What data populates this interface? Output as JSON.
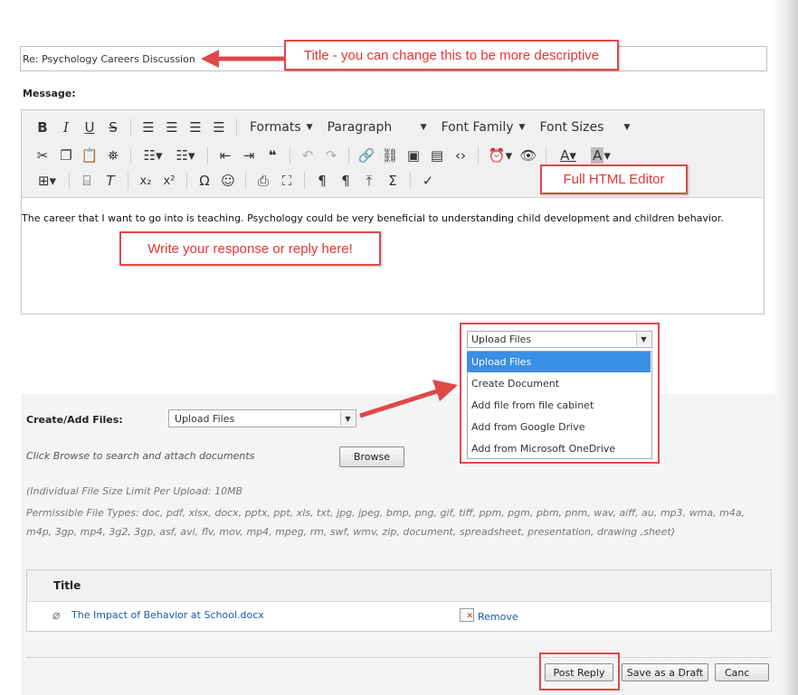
{
  "title_field": {
    "value": "Re: Psychology Careers Discussion"
  },
  "message_label": "Message:",
  "toolbar": {
    "formats": "Formats",
    "paragraph": "Paragraph",
    "font_family": "Font Family",
    "font_sizes": "Font Sizes",
    "row1_icons": [
      "bold-icon",
      "italic-icon",
      "underline-icon",
      "strikethrough-icon",
      "align-left-icon",
      "align-center-icon",
      "align-right-icon",
      "align-justify-icon"
    ],
    "row2_icons": [
      "cut-icon",
      "copy-icon",
      "paste-icon",
      "find-icon",
      "bullet-list-icon",
      "numbered-list-icon",
      "outdent-icon",
      "indent-icon",
      "blockquote-icon",
      "undo-icon",
      "redo-icon",
      "link-icon",
      "unlink-icon",
      "image-icon",
      "media-icon",
      "code-icon",
      "time-icon",
      "preview-icon",
      "text-color-icon",
      "background-color-icon"
    ],
    "row3_icons": [
      "table-icon",
      "horizontal-rule-icon",
      "clear-format-icon",
      "subscript-icon",
      "superscript-icon",
      "special-char-icon",
      "emoticon-icon",
      "print-icon",
      "fullscreen-icon",
      "show-blocks-icon",
      "paragraph-mark-icon",
      "upload-icon",
      "sigma-icon",
      "spellcheck-icon"
    ]
  },
  "editor_content": "The career that I want to go into is teaching.  Psychology could be very beneficial to understanding child development and children behavior.",
  "callouts": {
    "title": "Title - you can change this to be more descriptive",
    "editor": "Full HTML Editor",
    "response": "Write your response or reply here!"
  },
  "dropdown_popup": {
    "selected": "Upload Files",
    "options": [
      "Upload Files",
      "Create Document",
      "Add file from file cabinet",
      "Add from Google Drive",
      "Add from Microsoft OneDrive"
    ],
    "highlighted_index": 0
  },
  "files": {
    "label": "Create/Add Files:",
    "select_value": "Upload Files",
    "browse_hint": "Click Browse to search and attach documents",
    "browse_button": "Browse",
    "size_limit": "(Individual File Size Limit Per Upload: 10MB",
    "permissible": "Permissible File Types: doc, pdf, xlsx, docx, pptx, ppt, xls, txt, jpg, jpeg, bmp, png, gif, tiff, ppm, pgm, pbm, pnm, wav, aiff, au, mp3, wma, m4a, m4p, 3gp, mp4, 3g2, 3gp, asf, avi, flv, mov, mp4, mpeg, rm, swf, wmv, zip, document, spreadsheet, presentation, drawing ,sheet)",
    "table_header": "Title",
    "attachment_name": "The Impact of Behavior at School.docx",
    "remove_label": "Remove"
  },
  "actions": {
    "post_reply": "Post Reply",
    "save_draft": "Save as a Draft",
    "cancel": "Canc"
  },
  "colors": {
    "callout_red": "#e04848",
    "highlight_blue": "#3a8ee6",
    "link_blue": "#1a5aa6"
  }
}
